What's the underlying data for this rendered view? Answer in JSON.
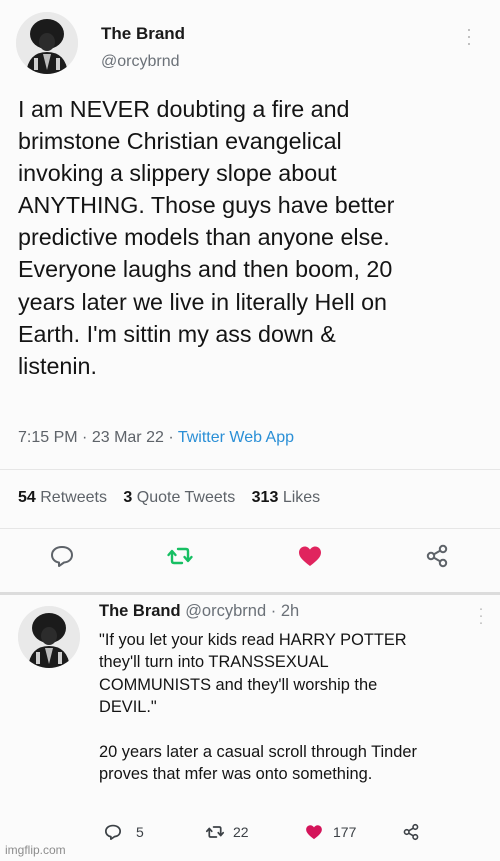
{
  "tweet": {
    "name": "The Brand",
    "handle": "@orcybrnd",
    "text": "I am NEVER doubting a fire and\nbrimstone Christian evangelical\ninvoking a slippery slope about\nANYTHING. Those guys have better\npredictive models than anyone else.\nEveryone laughs and then boom, 20\nyears later we live in literally Hell on\nEarth. I'm sittin my ass down &\nlistenin.",
    "time": "7:15 PM",
    "date": "23 Mar 22",
    "source": "Twitter Web App",
    "retweets_count": "54",
    "retweets_label": "Retweets",
    "quote_count": "3",
    "quote_label": "Quote Tweets",
    "likes_count": "313",
    "likes_label": "Likes",
    "liked": true,
    "icons": [
      "reply-icon",
      "retweet-icon",
      "like-icon",
      "share-icon",
      "more-icon"
    ]
  },
  "reply": {
    "name": "The Brand",
    "handle": "@orcybrnd",
    "age": "2h",
    "text": "\"If you let your kids read HARRY POTTER\nthey'll turn into TRANSSEXUAL\nCOMMUNISTS and they'll worship the\nDEVIL.\"\n\n20 years later a casual scroll through Tinder\nproves that mfer was onto something.",
    "reply_count": "5",
    "retweet_count": "22",
    "like_count": "177",
    "liked": true
  },
  "colors": {
    "accent": "#17bf63",
    "like": "#e0245e",
    "link": "#2a8fd6",
    "muted": "#5e6369"
  },
  "watermark": "imgflip.com"
}
